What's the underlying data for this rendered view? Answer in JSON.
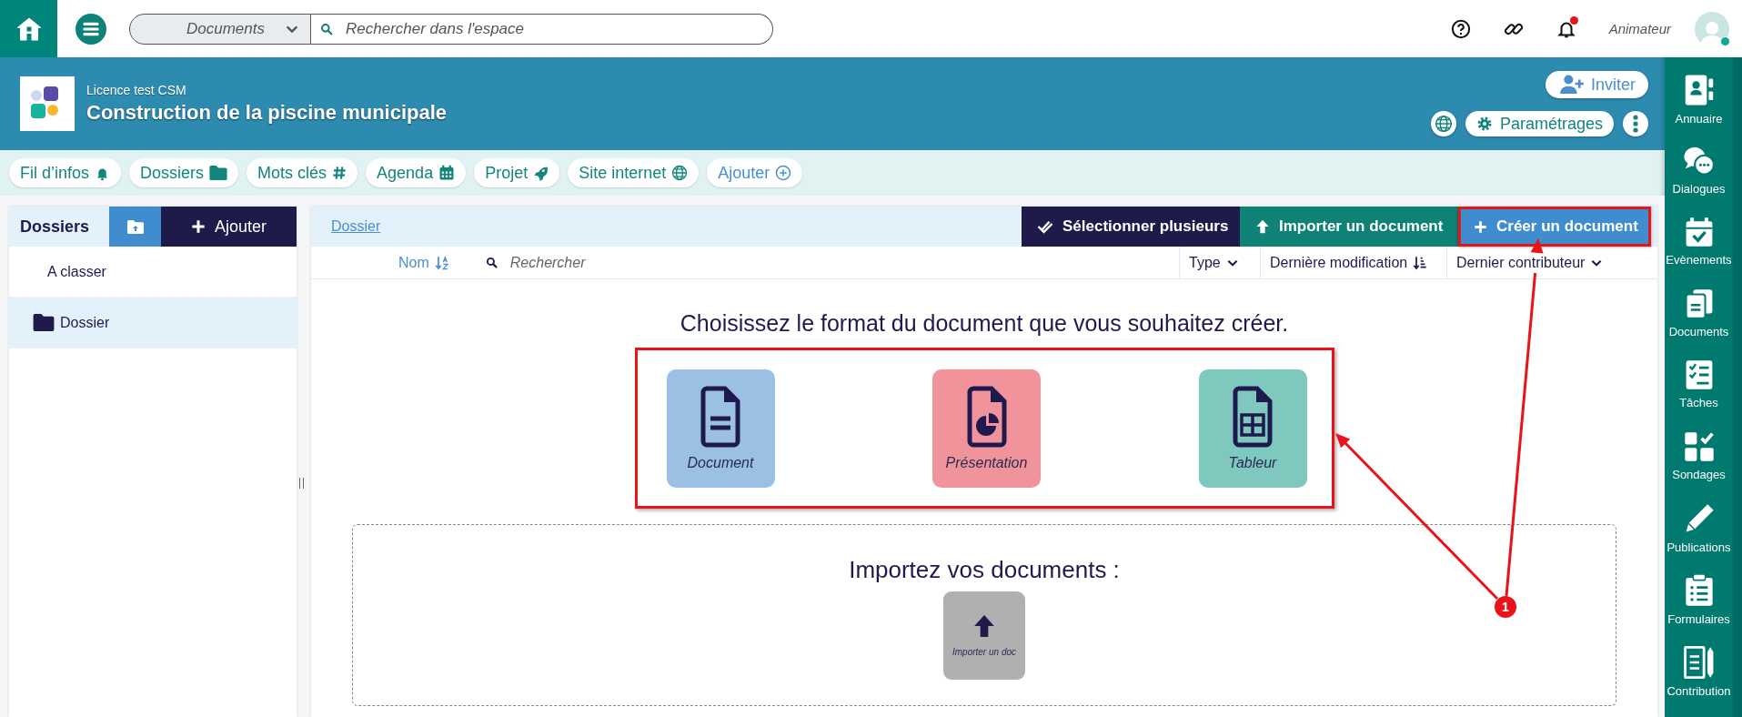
{
  "top_bar": {
    "scope": {
      "value": "Documents"
    },
    "search": {
      "placeholder": "Rechercher dans l'espace"
    },
    "has_notifications": true,
    "user": {
      "role": "Animateur",
      "online": true
    }
  },
  "header": {
    "subtitle": "Licence test CSM",
    "title": "Construction de la piscine municipale",
    "invite_label": "Inviter",
    "settings_label": "Paramétrages"
  },
  "tabs": [
    {
      "label": "Fil d’infos",
      "kind": "page"
    },
    {
      "label": "Dossiers",
      "kind": "page"
    },
    {
      "label": "Mots clés",
      "kind": "page"
    },
    {
      "label": "Agenda",
      "kind": "page"
    },
    {
      "label": "Projet",
      "kind": "page"
    },
    {
      "label": "Site internet",
      "kind": "page"
    },
    {
      "label": "Ajouter",
      "kind": "add"
    }
  ],
  "folders": {
    "title": "Dossiers",
    "add_label": "Ajouter",
    "items": [
      {
        "label": "A classer",
        "kind": "plain",
        "selected": false
      },
      {
        "label": "Dossier",
        "kind": "folder",
        "selected": true
      }
    ]
  },
  "documents": {
    "breadcrumb": "Dossier",
    "actions": [
      {
        "label": "Sélectionner plusieurs",
        "kind": "select",
        "highlighted": false
      },
      {
        "label": "Importer un document",
        "kind": "import",
        "highlighted": false
      },
      {
        "label": "Créer un document",
        "kind": "create",
        "highlighted": true
      }
    ],
    "columns": [
      {
        "label": "Nom",
        "kind": "sort",
        "active": true
      },
      {
        "label": "Type",
        "kind": "menu",
        "active": false
      },
      {
        "label": "Dernière modification",
        "kind": "sort",
        "active": false
      },
      {
        "label": "Dernier contributeur",
        "kind": "menu",
        "active": false
      }
    ],
    "search": {
      "placeholder": "Rechercher"
    },
    "format_picker": {
      "heading": "Choisissez le format du document que vous souhaitez créer.",
      "highlighted": true,
      "formats": [
        {
          "label": "Document",
          "color": "#9ac0e4"
        },
        {
          "label": "Présentation",
          "color": "#f0939b"
        },
        {
          "label": "Tableur",
          "color": "#7fc8bd"
        }
      ]
    },
    "import": {
      "heading": "Importez vos documents :",
      "tile_label": "Importer un doc"
    }
  },
  "sidebar": {
    "items": [
      {
        "label": "Annuaire"
      },
      {
        "label": "Dialogues"
      },
      {
        "label": "Evènements"
      },
      {
        "label": "Documents"
      },
      {
        "label": "Tâches"
      },
      {
        "label": "Sondages"
      },
      {
        "label": "Publications"
      },
      {
        "label": "Formulaires"
      },
      {
        "label": "Contribution"
      }
    ]
  },
  "annotation": {
    "badge": "1"
  }
}
